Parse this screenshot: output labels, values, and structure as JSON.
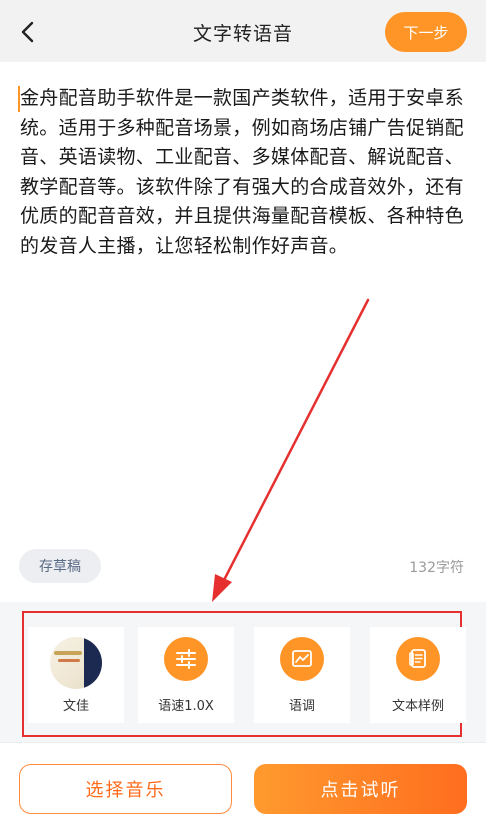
{
  "header": {
    "title": "文字转语音",
    "next_label": "下一步"
  },
  "editor": {
    "text": "金舟配音助手软件是一款国产类软件，适用于安卓系统。适用于多种配音场景，例如商场店铺广告促销配音、英语读物、工业配音、多媒体配音、解说配音、教学配音等。该软件除了有强大的合成音效外，还有优质的配音音效，并且提供海量配音模板、各种特色的发音人主播，让您轻松制作好声音。",
    "draft_label": "存草稿",
    "char_count": "132字符"
  },
  "toolbar": {
    "items": [
      {
        "label": "文佳",
        "icon": "voice-avatar-icon"
      },
      {
        "label": "语速1.0X",
        "icon": "sliders-icon"
      },
      {
        "label": "语调",
        "icon": "chart-icon"
      },
      {
        "label": "文本样例",
        "icon": "document-icon"
      }
    ]
  },
  "bottom": {
    "music_label": "选择音乐",
    "listen_label": "点击试听"
  },
  "colors": {
    "accent": "#ff9526",
    "highlight_box": "#e63030"
  }
}
